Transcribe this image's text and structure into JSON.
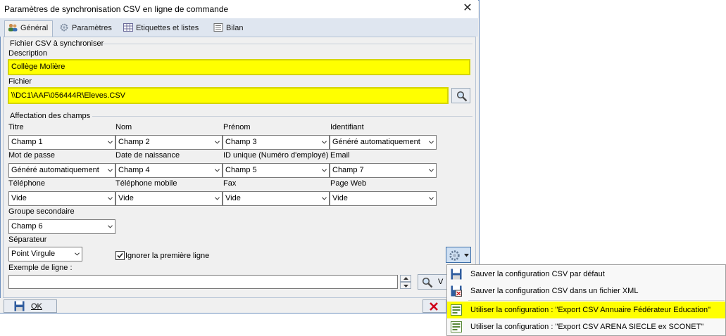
{
  "window": {
    "title": "Paramètres de synchronisation CSV en ligne de commande"
  },
  "tabs": [
    {
      "label": "Général",
      "active": true,
      "icon": "users-icon"
    },
    {
      "label": "Paramètres",
      "active": false,
      "icon": "gear-icon"
    },
    {
      "label": "Etiquettes et listes",
      "active": false,
      "icon": "table-icon"
    },
    {
      "label": "Bilan",
      "active": false,
      "icon": "list-icon"
    }
  ],
  "csv_file": {
    "group_label": "Fichier CSV à synchroniser",
    "description_label": "Description",
    "description_value": "Collège Molière",
    "file_label": "Fichier",
    "file_value": "\\\\DC1\\AAF\\056444R\\Eleves.CSV"
  },
  "mapping": {
    "group_label": "Affectation des champs",
    "fields": [
      {
        "label": "Titre",
        "value": "Champ 1"
      },
      {
        "label": "Nom",
        "value": "Champ 2"
      },
      {
        "label": "Prénom",
        "value": "Champ 3"
      },
      {
        "label": "Identifiant",
        "value": "Généré automatiquement"
      },
      {
        "label": "Mot de passe",
        "value": "Généré automatiquement"
      },
      {
        "label": "Date de naissance",
        "value": "Champ 4"
      },
      {
        "label": "ID unique (Numéro d'employé)",
        "value": "Champ 5"
      },
      {
        "label": "Email",
        "value": "Champ 7"
      },
      {
        "label": "Téléphone",
        "value": "Vide"
      },
      {
        "label": "Téléphone mobile",
        "value": "Vide"
      },
      {
        "label": "Fax",
        "value": "Vide"
      },
      {
        "label": "Page Web",
        "value": "Vide"
      },
      {
        "label": "Groupe secondaire",
        "value": "Champ 6"
      }
    ],
    "separator_label": "Séparateur",
    "separator_value": "Point Virgule",
    "ignore_first_line_label": "Ignorer la première ligne",
    "ignore_first_line_checked": true,
    "example_label": "Exemple de ligne :",
    "example_value": "",
    "view_button_label": "V"
  },
  "footer": {
    "ok_label": "OK"
  },
  "context_menu": {
    "items": [
      {
        "label": "Sauver la configuration CSV par défaut",
        "icon": "save-icon",
        "highlighted": false
      },
      {
        "label": "Sauver la configuration CSV dans un fichier XML",
        "icon": "save-xml-icon",
        "highlighted": false
      },
      {
        "label": "Utiliser la configuration : \"Export CSV Annuaire Fédérateur Education\"",
        "icon": "config-icon",
        "highlighted": true
      },
      {
        "label": "Utiliser la configuration : \"Export CSV ARENA SIECLE ex SCONET\"",
        "icon": "config-icon",
        "highlighted": false
      }
    ]
  },
  "colors": {
    "highlight": "#ffff00",
    "accent_border": "#6d8fbd",
    "close_red": "#d0021b"
  }
}
